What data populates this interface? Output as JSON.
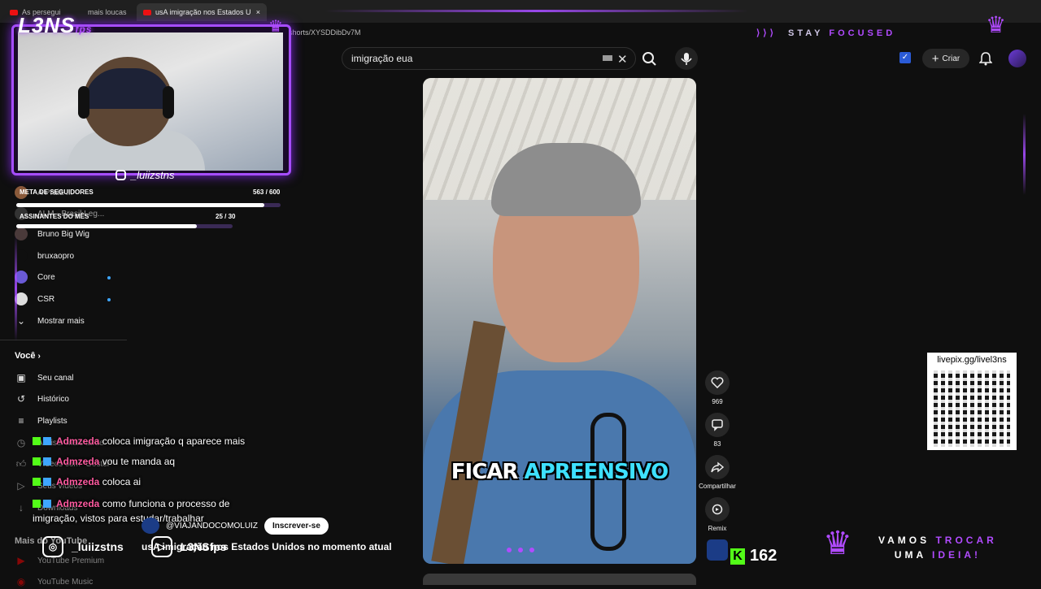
{
  "browser": {
    "tabs": [
      {
        "label": "As persegui"
      },
      {
        "label": "mais loucas"
      },
      {
        "label": "usA imigração nos Estados U"
      }
    ],
    "url": "shorts/XYSDDibDv7M"
  },
  "overlay": {
    "logo": "L3NS",
    "logo_suffix": "fps",
    "stay_focused_1": "STAY",
    "stay_focused_2": "FOCUSED",
    "instagram_handle": "_luiizstns",
    "goal_followers_label": "META DE SEGUIDORES",
    "goal_followers_value": "563 / 600",
    "goal_followers_fraction": 0.938,
    "goal_subs_label": "ASSINANTES DO MÊS",
    "goal_subs_value": "25 / 30",
    "goal_subs_fraction": 0.833,
    "socials_instagram": "_luiizstns",
    "socials_youtube": "L3NSfps",
    "kick_count": "162",
    "vamos_line1_a": "VAMOS",
    "vamos_line1_b": "TROCAR",
    "vamos_line2_a": "UMA",
    "vamos_line2_b": "IDEIA!",
    "qr_label": "livepix.gg/livel3ns"
  },
  "topbar": {
    "search_value": "imigração eua",
    "create_label": "Criar"
  },
  "sidebar": {
    "subscriptions": [
      {
        "label": "A Praia ..."
      },
      {
        "label": "ALM - Brasil Leg..."
      },
      {
        "label": "Bruno Big Wig"
      },
      {
        "label": "bruxaopro"
      },
      {
        "label": "Core"
      },
      {
        "label": "CSR"
      }
    ],
    "show_more": "Mostrar mais",
    "you_heading": "Você",
    "you_items": [
      {
        "label": "Seu canal"
      },
      {
        "label": "Histórico"
      },
      {
        "label": "Playlists"
      },
      {
        "label": "Assistir mais tarde"
      },
      {
        "label": "Vídeos com \"Gostei\""
      },
      {
        "label": "Seus vídeos"
      },
      {
        "label": "Downloads"
      }
    ],
    "more_heading": "Mais do YouTube",
    "more_items": [
      {
        "label": "YouTube Premium"
      },
      {
        "label": "YouTube Music"
      }
    ]
  },
  "chat": [
    {
      "user": "Admzeda",
      "message": "coloca imigração q aparece mais"
    },
    {
      "user": "Admzeda",
      "message": "vou te manda aq"
    },
    {
      "user": "Admzeda",
      "message": "coloca ai"
    },
    {
      "user": "Admzeda",
      "message": "como funciona o processo de",
      "message2": "imigração, vistos para estudar/trabalhar"
    }
  ],
  "short": {
    "caption_word1": "FICAR",
    "caption_word2": "APREENSIVO",
    "channel": "@VIAJANDOCOMOLUIZ",
    "subscribe_label": "Inscrever-se",
    "description": "usA imigração nos Estados Unidos no momento atual",
    "likes": "969",
    "comments": "83",
    "share_label": "Compartilhar",
    "remix_label": "Remix"
  },
  "colors": {
    "accent_purple": "#a64dff",
    "kick_green": "#53fc18",
    "caption_cyan": "#3ee0ff",
    "chat_user_pink": "#ff5aa0"
  }
}
